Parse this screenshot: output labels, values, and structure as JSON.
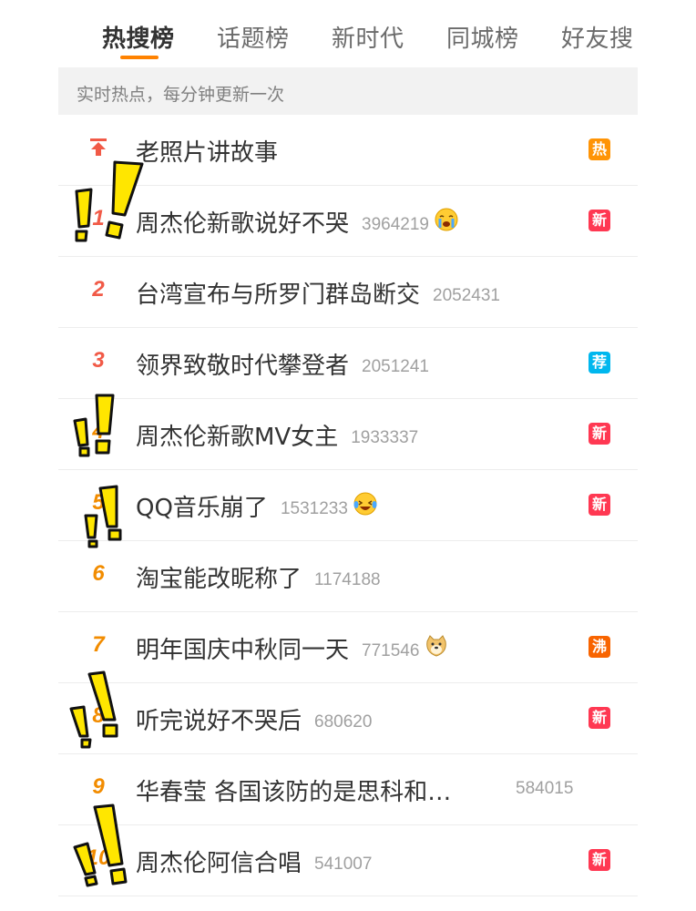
{
  "tabs": [
    {
      "label": "热搜榜",
      "active": true
    },
    {
      "label": "话题榜",
      "active": false
    },
    {
      "label": "新时代",
      "active": false
    },
    {
      "label": "同城榜",
      "active": false
    },
    {
      "label": "好友搜",
      "active": false
    }
  ],
  "subheader": "实时热点，每分钟更新一次",
  "colors": {
    "accent": "#ff8200",
    "top_rank": "#f15a47",
    "rank": "#f28c00",
    "badge_hot": "#ff9406",
    "badge_new": "#ff3852",
    "badge_recommend": "#00b7ee",
    "badge_boil": "#f86400",
    "exclaim": "#ffe600"
  },
  "items": [
    {
      "rank": "",
      "rank_icon": "pin-up-arrow-icon",
      "title": "老照片讲故事",
      "count": "",
      "emoji": "",
      "badge": "热",
      "badge_type": "hot"
    },
    {
      "rank": "1",
      "title": "周杰伦新歌说好不哭",
      "count": "3964219",
      "emoji": "crying-face-emoji",
      "badge": "新",
      "badge_type": "new"
    },
    {
      "rank": "2",
      "title": "台湾宣布与所罗门群岛断交",
      "count": "2052431",
      "emoji": "",
      "badge": "",
      "badge_type": ""
    },
    {
      "rank": "3",
      "title": "领界致敬时代攀登者",
      "count": "2051241",
      "emoji": "",
      "badge": "荐",
      "badge_type": "recommend"
    },
    {
      "rank": "4",
      "title": "周杰伦新歌MV女主",
      "count": "1933337",
      "emoji": "",
      "badge": "新",
      "badge_type": "new"
    },
    {
      "rank": "5",
      "title": "QQ音乐崩了",
      "count": "1531233",
      "emoji": "laughing-tears-emoji",
      "badge": "新",
      "badge_type": "new"
    },
    {
      "rank": "6",
      "title": "淘宝能改昵称了",
      "count": "1174188",
      "emoji": "",
      "badge": "",
      "badge_type": ""
    },
    {
      "rank": "7",
      "title": "明年国庆中秋同一天",
      "count": "771546",
      "emoji": "doge-emoji",
      "badge": "沸",
      "badge_type": "boil"
    },
    {
      "rank": "8",
      "title": "听完说好不哭后",
      "count": "680620",
      "emoji": "",
      "badge": "新",
      "badge_type": "new"
    },
    {
      "rank": "9",
      "title": "华春莹 各国该防的是思科和…",
      "count": "584015",
      "emoji": "",
      "badge": "",
      "badge_type": ""
    },
    {
      "rank": "10",
      "title": "周杰伦阿信合唱",
      "count": "541007",
      "emoji": "",
      "badge": "新",
      "badge_type": "new"
    }
  ]
}
